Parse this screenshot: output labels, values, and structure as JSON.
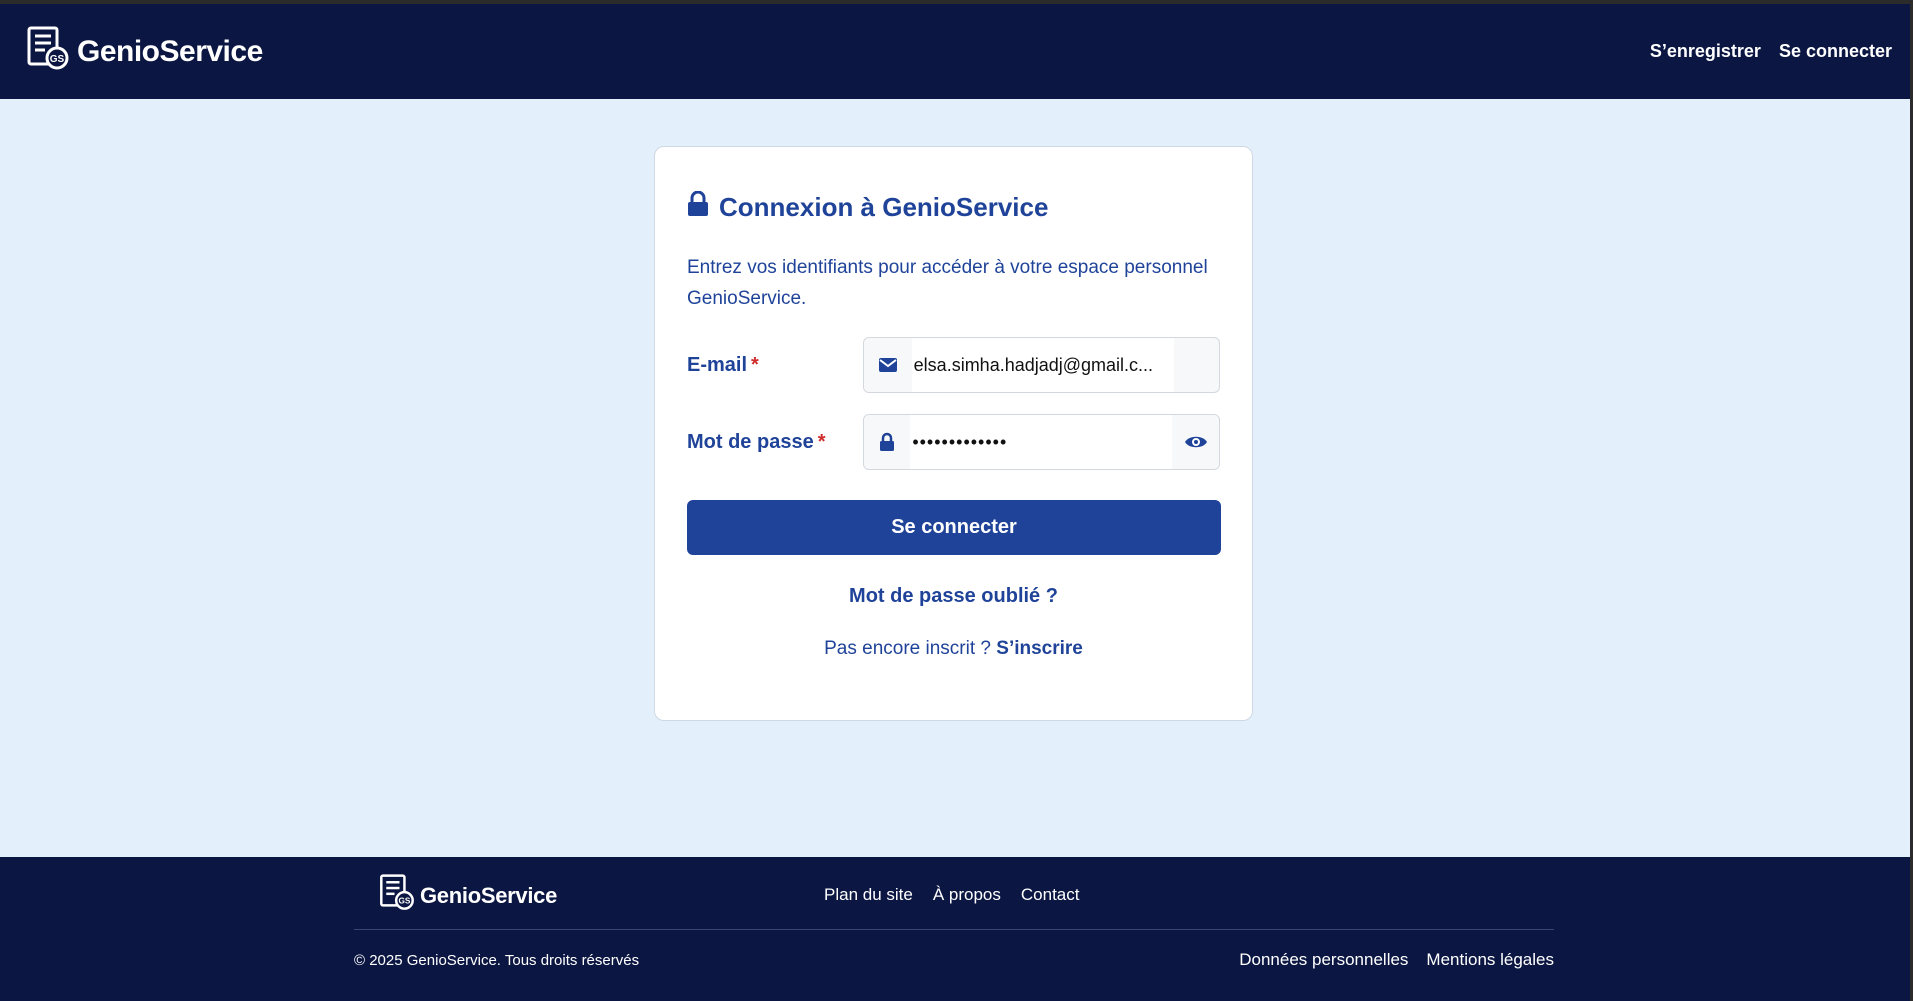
{
  "header": {
    "brand": "GenioService",
    "nav": [
      {
        "label": "S’enregistrer"
      },
      {
        "label": "Se connecter"
      }
    ]
  },
  "login": {
    "title": "Connexion à GenioService",
    "intro": "Entrez vos identifiants pour accéder à votre espace personnel GenioService.",
    "email_label": "E-mail",
    "email_value": "elsa.simha.hadjadj@gmail.c...",
    "password_label": "Mot de passe",
    "password_value": "•••••••••••••",
    "required_mark": "*",
    "submit_label": "Se connecter",
    "forgot_label": "Mot de passe oublié ?",
    "signup_prompt": "Pas encore inscrit ?",
    "signup_link": "S’inscrire"
  },
  "footer": {
    "brand": "GenioService",
    "links": [
      {
        "label": "Plan du site"
      },
      {
        "label": "À propos"
      },
      {
        "label": "Contact"
      }
    ],
    "copyright": "© 2025 GenioService. Tous droits réservés",
    "legal": [
      {
        "label": "Données personnelles"
      },
      {
        "label": "Mentions légales"
      }
    ]
  },
  "colors": {
    "navy": "#0b1642",
    "primary": "#1f4399",
    "background": "#e3f0fb",
    "required": "#d02c2c"
  },
  "icons": {
    "logo": "document-gear-icon",
    "title": "lock-icon",
    "email": "envelope-icon",
    "password": "lock-icon",
    "toggle": "eye-icon"
  }
}
